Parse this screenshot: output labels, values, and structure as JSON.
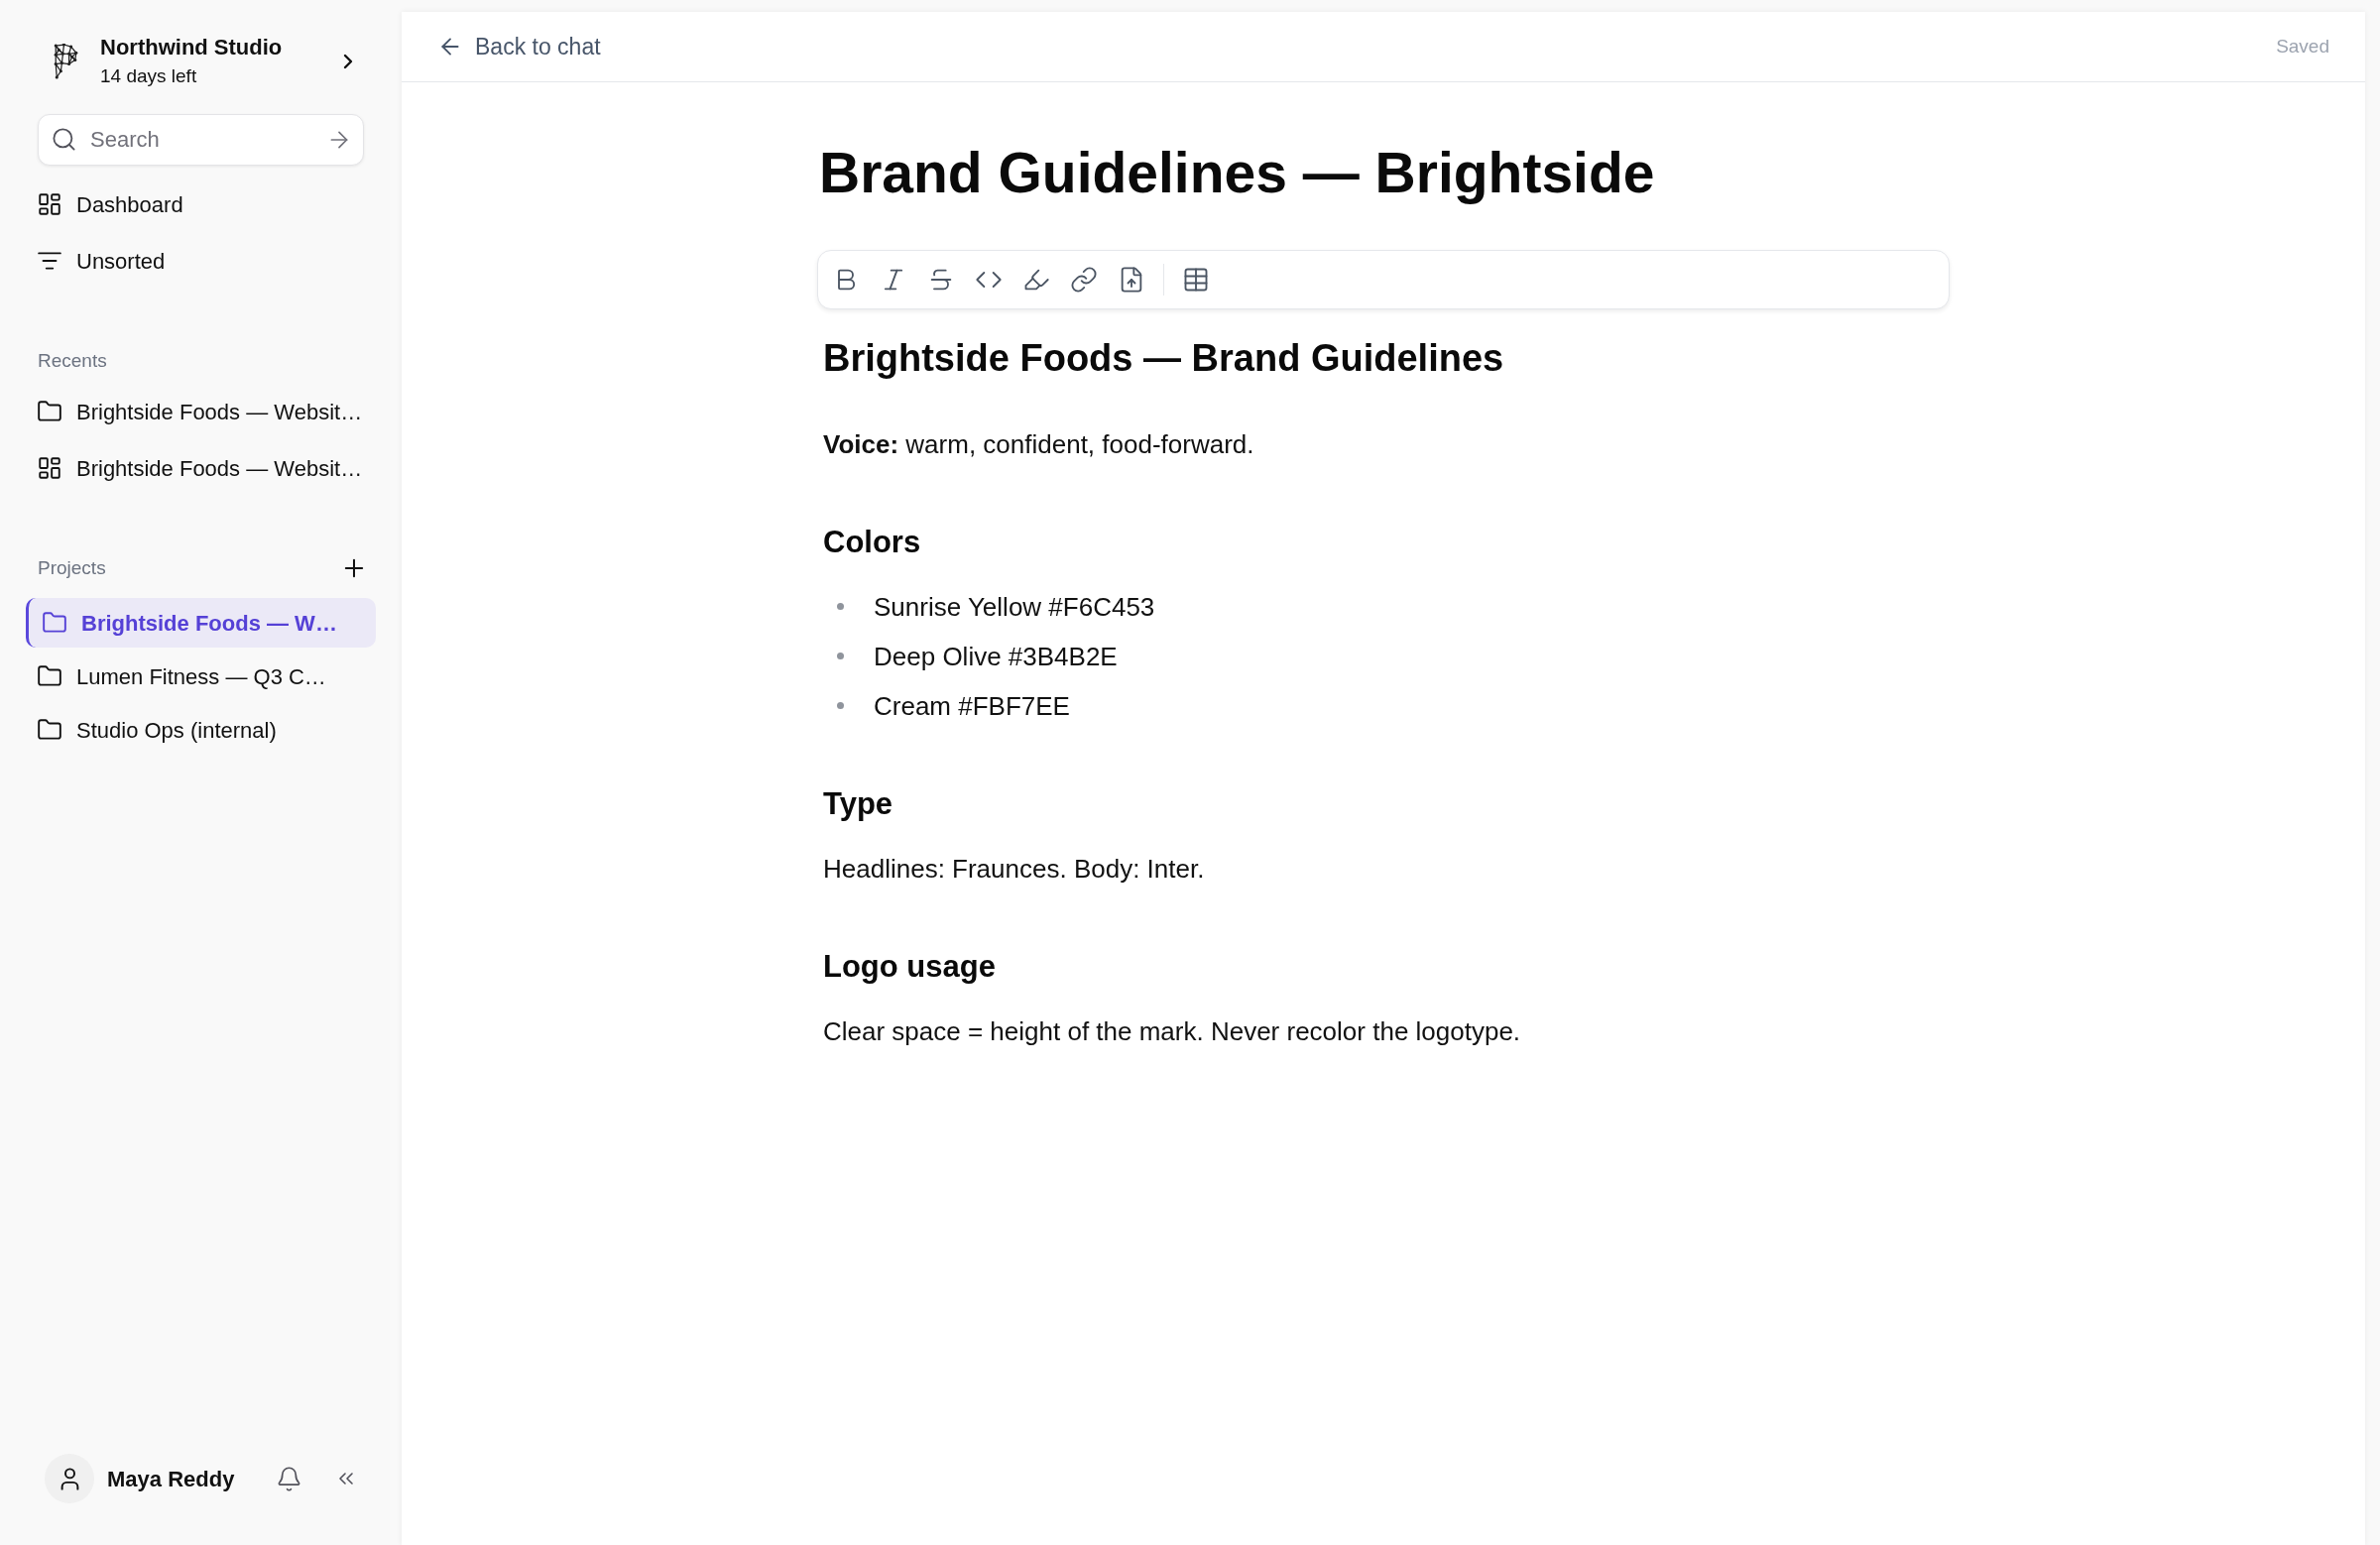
{
  "sidebar": {
    "workspace": {
      "name": "Northwind Studio",
      "subtitle": "14 days left"
    },
    "search": {
      "placeholder": "Search"
    },
    "nav": [
      {
        "label": "Dashboard",
        "kind": "board"
      },
      {
        "label": "Unsorted",
        "kind": "filter"
      }
    ],
    "recents": {
      "heading": "Recents",
      "items": [
        {
          "label": "Brightside Foods — Websit…",
          "kind": "folder"
        },
        {
          "label": "Brightside Foods — Websit…",
          "kind": "board"
        }
      ]
    },
    "projects": {
      "heading": "Projects",
      "items": [
        {
          "label": "Brightside Foods — W…",
          "selected": true
        },
        {
          "label": "Lumen Fitness — Q3 C…",
          "selected": false
        },
        {
          "label": "Studio Ops (internal)",
          "selected": false
        }
      ]
    },
    "user": {
      "name": "Maya Reddy"
    }
  },
  "topbar": {
    "back_link": "Back to chat",
    "status": "Saved"
  },
  "document": {
    "title": "Brand Guidelines — Brightside",
    "blocks": [
      {
        "kind": "heading1",
        "text": "Brightside Foods — Brand Guidelines"
      },
      {
        "kind": "paragraph",
        "text": "**Voice:** warm, confident, food-forward."
      },
      {
        "kind": "heading2",
        "text": "Colors"
      },
      {
        "kind": "bullet_list",
        "items": [
          "Sunrise Yellow #F6C453",
          "Deep Olive #3B4B2E",
          "Cream #FBF7EE"
        ]
      },
      {
        "kind": "heading2",
        "text": "Type"
      },
      {
        "kind": "paragraph",
        "text": "Headlines: Fraunces. Body: Inter."
      },
      {
        "kind": "heading2",
        "text": "Logo usage"
      },
      {
        "kind": "paragraph",
        "text": "Clear space = height of the mark. Never recolor the logotype."
      }
    ]
  }
}
